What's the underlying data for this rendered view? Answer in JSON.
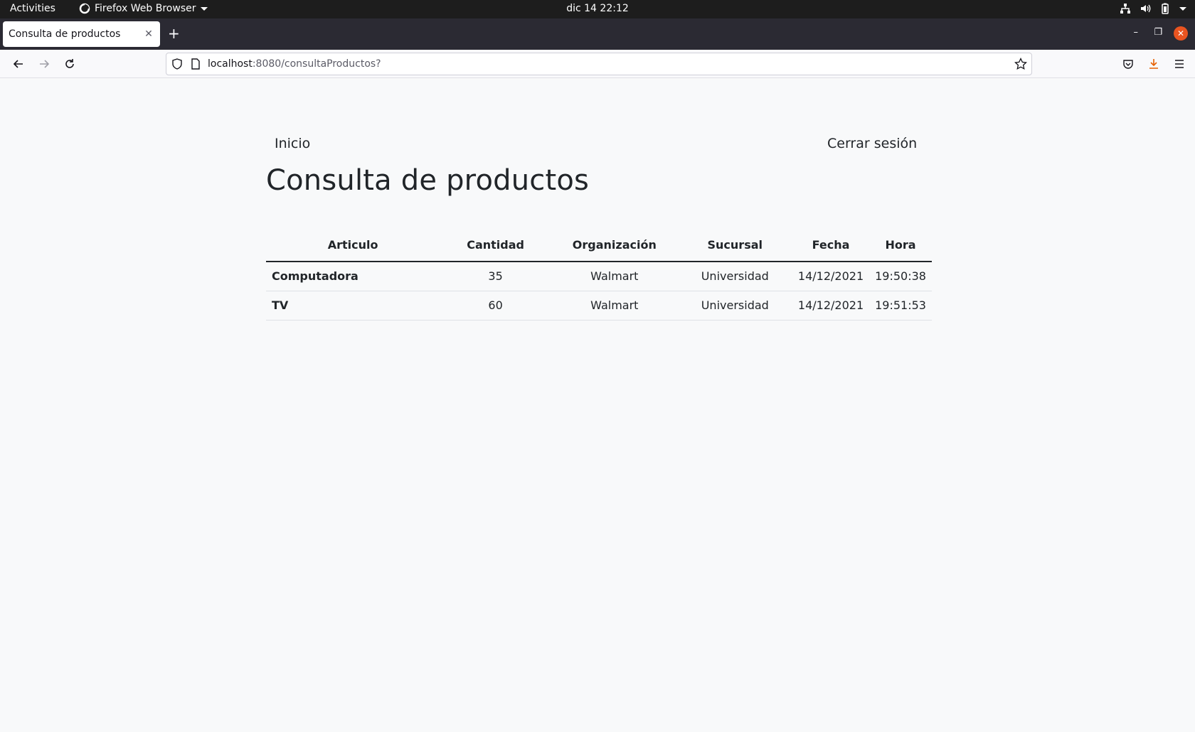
{
  "system_bar": {
    "activities": "Activities",
    "app_name": "Firefox Web Browser",
    "clock": "dic 14  22:12"
  },
  "browser": {
    "tab_title": "Consulta de productos",
    "url_host": "localhost",
    "url_rest": ":8080/consultaProductos?"
  },
  "page": {
    "nav_home": "Inicio",
    "nav_logout": "Cerrar sesión",
    "title": "Consulta de productos",
    "table": {
      "headers": [
        "Articulo",
        "Cantidad",
        "Organización",
        "Sucursal",
        "Fecha",
        "Hora"
      ],
      "rows": [
        [
          "Computadora",
          "35",
          "Walmart",
          "Universidad",
          "14/12/2021",
          "19:50:38"
        ],
        [
          "TV",
          "60",
          "Walmart",
          "Universidad",
          "14/12/2021",
          "19:51:53"
        ]
      ]
    }
  },
  "colors": {
    "system_bar": "#1d1d1d",
    "tab_strip": "#2b2a33",
    "page_background": "#f8f9fa",
    "text": "#212529",
    "close_accent": "#e95420",
    "download_accent": "#e66000"
  }
}
